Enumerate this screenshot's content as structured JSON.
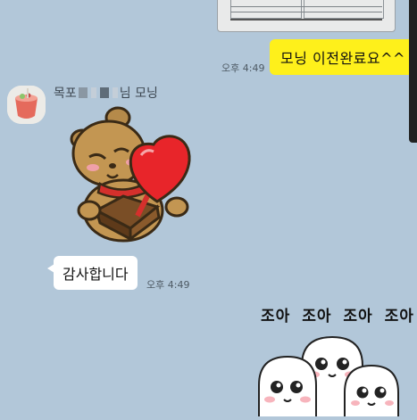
{
  "chat": {
    "messages": [
      {
        "sender": "me",
        "type": "image",
        "time": ""
      },
      {
        "sender": "me",
        "type": "text",
        "text": "모닝 이전완료요^^",
        "time": "오후 4:49"
      },
      {
        "sender": "other",
        "type": "sticker",
        "sticker": "bear-holding-heart"
      },
      {
        "sender": "other",
        "type": "text",
        "text": "감사합니다",
        "time": "오후 4:49"
      },
      {
        "sender": "me",
        "type": "sticker",
        "sticker": "three-white-ghosts",
        "caption": "조아 조아 조아 조아"
      }
    ],
    "other_user": {
      "name_prefix": "목포",
      "name_suffix": "님 모닝",
      "avatar": "drink-cup-avatar"
    }
  },
  "colors": {
    "background": "#b2c7d9",
    "my_bubble": "#fef01b",
    "other_bubble": "#ffffff"
  }
}
